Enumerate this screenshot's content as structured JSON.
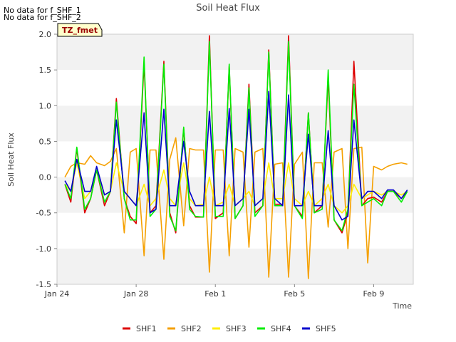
{
  "notes": [
    "No data for f_SHF_1",
    "No data for f_SHF_2"
  ],
  "badge": "TZ_fmet",
  "colors": {
    "SHF1": "#dd0000",
    "SHF2": "#f5a000",
    "SHF3": "#ffee00",
    "SHF4": "#00ee00",
    "SHF5": "#0000cc",
    "band": "#f2f2f2",
    "badge_bg": "#ffffcc",
    "badge_text": "#990000"
  },
  "chart_data": {
    "type": "line",
    "title": "Soil Heat Flux",
    "xlabel": "Time",
    "ylabel": "Soil Heat Flux",
    "ylim": [
      -1.5,
      2.0
    ],
    "yticks": [
      -1.5,
      -1.0,
      -0.5,
      0.0,
      0.5,
      1.0,
      1.5,
      2.0
    ],
    "ytick_labels": [
      "-1.5",
      "-1.0",
      "-0.5",
      "0.0",
      "0.5",
      "1.0",
      "1.5",
      "2.0"
    ],
    "xlim": [
      "Jan 24",
      "Feb 11"
    ],
    "xticks": [
      "Jan 24",
      "Jan 28",
      "Feb 1",
      "Feb 5",
      "Feb 9"
    ],
    "legend_position": "bottom",
    "grid": "alternating horizontal bands",
    "x": [
      "Jan 24.4",
      "Jan 24.7",
      "Jan 25.0",
      "Jan 25.4",
      "Jan 25.7",
      "Jan 26.0",
      "Jan 26.4",
      "Jan 26.7",
      "Jan 27.0",
      "Jan 27.4",
      "Jan 27.7",
      "Jan 28.0",
      "Jan 28.4",
      "Jan 28.7",
      "Jan 29.0",
      "Jan 29.4",
      "Jan 29.7",
      "Jan 30.0",
      "Jan 30.4",
      "Jan 30.7",
      "Jan 31.0",
      "Jan 31.4",
      "Jan 31.7",
      "Feb 1.0",
      "Feb 1.4",
      "Feb 1.7",
      "Feb 2.0",
      "Feb 2.4",
      "Feb 2.7",
      "Feb 3.0",
      "Feb 3.4",
      "Feb 3.7",
      "Feb 4.0",
      "Feb 4.4",
      "Feb 4.7",
      "Feb 5.0",
      "Feb 5.4",
      "Feb 5.7",
      "Feb 6.0",
      "Feb 6.4",
      "Feb 6.7",
      "Feb 7.0",
      "Feb 7.4",
      "Feb 7.7",
      "Feb 8.0",
      "Feb 8.4",
      "Feb 8.7",
      "Feb 9.0",
      "Feb 9.4",
      "Feb 9.7",
      "Feb 10.0",
      "Feb 10.4",
      "Feb 10.7"
    ],
    "series": [
      {
        "name": "SHF1",
        "values": [
          -0.1,
          -0.35,
          0.4,
          -0.5,
          -0.3,
          0.1,
          -0.4,
          -0.2,
          1.1,
          -0.3,
          -0.55,
          -0.65,
          1.6,
          -0.5,
          -0.4,
          1.62,
          -0.5,
          -0.78,
          0.68,
          -0.4,
          -0.56,
          -0.56,
          1.98,
          -0.58,
          -0.5,
          1.55,
          -0.58,
          -0.4,
          1.3,
          -0.5,
          -0.4,
          1.78,
          -0.38,
          -0.38,
          1.98,
          -0.4,
          -0.55,
          0.9,
          -0.5,
          -0.4,
          1.4,
          -0.6,
          -0.78,
          -0.5,
          1.62,
          -0.4,
          -0.3,
          -0.28,
          -0.35,
          -0.2,
          -0.2,
          -0.3,
          -0.2
        ]
      },
      {
        "name": "SHF2",
        "values": [
          0.0,
          0.15,
          0.2,
          0.18,
          0.3,
          0.2,
          0.16,
          0.22,
          0.4,
          -0.78,
          0.35,
          0.4,
          -1.1,
          0.38,
          0.38,
          -1.15,
          0.25,
          0.55,
          -0.68,
          0.4,
          0.38,
          0.38,
          -1.33,
          0.38,
          0.38,
          -1.1,
          0.4,
          0.35,
          -0.98,
          0.35,
          0.4,
          -1.4,
          0.18,
          0.2,
          -1.4,
          0.18,
          0.35,
          -1.42,
          0.2,
          0.2,
          -0.7,
          0.35,
          0.4,
          -1.0,
          0.4,
          0.42,
          -1.2,
          0.15,
          0.1,
          0.15,
          0.18,
          0.2,
          0.18
        ]
      },
      {
        "name": "SHF3",
        "values": [
          -0.1,
          -0.2,
          0.2,
          -0.3,
          -0.2,
          0.1,
          -0.25,
          -0.2,
          0.2,
          -0.2,
          -0.3,
          -0.4,
          -0.1,
          -0.4,
          -0.3,
          0.1,
          -0.3,
          -0.4,
          0.2,
          -0.3,
          -0.4,
          -0.38,
          0.0,
          -0.4,
          -0.35,
          -0.1,
          -0.4,
          -0.3,
          -0.2,
          -0.4,
          -0.3,
          0.2,
          -0.3,
          -0.3,
          0.2,
          -0.3,
          -0.4,
          -0.2,
          -0.4,
          -0.3,
          -0.1,
          -0.4,
          -0.5,
          -0.4,
          -0.1,
          -0.3,
          -0.25,
          -0.2,
          -0.25,
          -0.2,
          -0.2,
          -0.25,
          -0.2
        ]
      },
      {
        "name": "SHF4",
        "values": [
          -0.1,
          -0.3,
          0.42,
          -0.45,
          -0.3,
          0.1,
          -0.35,
          -0.2,
          1.05,
          -0.3,
          -0.6,
          -0.6,
          1.68,
          -0.55,
          -0.45,
          1.58,
          -0.55,
          -0.75,
          0.7,
          -0.45,
          -0.55,
          -0.56,
          1.9,
          -0.55,
          -0.55,
          1.58,
          -0.58,
          -0.4,
          1.25,
          -0.55,
          -0.4,
          1.75,
          -0.4,
          -0.4,
          1.9,
          -0.4,
          -0.58,
          0.9,
          -0.5,
          -0.45,
          1.5,
          -0.6,
          -0.75,
          -0.45,
          1.3,
          -0.4,
          -0.35,
          -0.3,
          -0.4,
          -0.2,
          -0.2,
          -0.35,
          -0.2
        ]
      },
      {
        "name": "SHF5",
        "values": [
          -0.05,
          -0.2,
          0.25,
          -0.2,
          -0.2,
          0.15,
          -0.25,
          -0.2,
          0.8,
          -0.2,
          -0.3,
          -0.4,
          0.9,
          -0.5,
          -0.45,
          0.95,
          -0.4,
          -0.4,
          0.5,
          -0.2,
          -0.4,
          -0.4,
          0.92,
          -0.4,
          -0.4,
          0.96,
          -0.4,
          -0.3,
          0.95,
          -0.4,
          -0.3,
          1.2,
          -0.3,
          -0.4,
          1.15,
          -0.4,
          -0.4,
          0.6,
          -0.4,
          -0.4,
          0.65,
          -0.4,
          -0.6,
          -0.55,
          0.8,
          -0.3,
          -0.2,
          -0.2,
          -0.3,
          -0.18,
          -0.18,
          -0.3,
          -0.18
        ]
      }
    ]
  }
}
